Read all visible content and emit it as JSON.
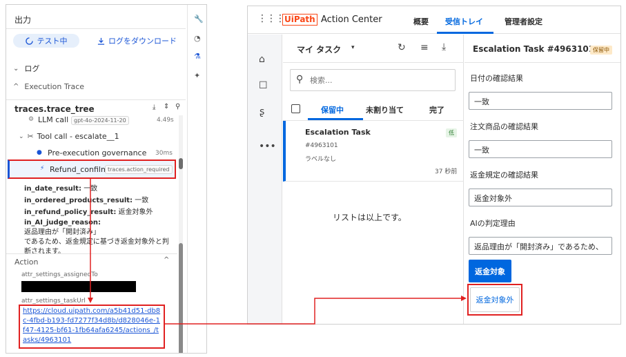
{
  "left": {
    "title": "出力",
    "status_chip": "テスト中",
    "download_logs": "ログをダウンロード",
    "log_label": "ログ",
    "execution_trace_label": "Execution Trace",
    "trace_tree_title": "traces.trace_tree",
    "trace_items": {
      "llm_call": "LLM call",
      "llm_model": "gpt-4o-2024-11-20",
      "llm_time": "4.49s",
      "tool_call": "Tool call - escalate__1",
      "pre_exec": "Pre-execution governance",
      "pre_exec_time": "30ms",
      "refund": "Refund_confilm",
      "refund_tag": "traces.action_required"
    },
    "results": {
      "date_key": "in_date_result:",
      "date_val": "一致",
      "ordered_key": "in_ordered_products_result:",
      "ordered_val": "一致",
      "refund_key": "in_refund_policy_result:",
      "refund_val": "返金対象外",
      "judge_key": "in_AI_judge_reason:",
      "judge_line1": "返品理由が「開封済み」",
      "judge_line2": "であるため、返金規定に基づき返金対象外と判",
      "judge_line3": "断されます。"
    },
    "action_label": "Action",
    "assigned_to_label": "attr_settings_assignedTo",
    "task_url_label": "attr_settings_taskUrl",
    "task_url": "https://cloud.uipath.com/a5b41d51-db8c-4fbd-b193-fd7277f34d8b/d828046e-1f47-4125-bf61-1fb64afa6245/actions_/tasks/4963101"
  },
  "right": {
    "brand_logo": "UiPath",
    "app_name": "Action Center",
    "tabs": [
      "概要",
      "受信トレイ",
      "管理者設定"
    ],
    "my_tasks": "マイ タスク",
    "search_placeholder": "検索...",
    "list_tabs": [
      "保留中",
      "未割り当て",
      "完了"
    ],
    "task": {
      "title": "Escalation Task",
      "priority": "低",
      "id": "#4963101",
      "label": "ラベルなし",
      "age": "37 秒前"
    },
    "end_of_list": "リストは以上です。",
    "detail": {
      "title": "Escalation Task #4963101",
      "status": "保留中",
      "fields": [
        {
          "label": "日付の確認結果",
          "value": "一致"
        },
        {
          "label": "注文商品の確認結果",
          "value": "一致"
        },
        {
          "label": "返金規定の確認結果",
          "value": "返金対象外"
        },
        {
          "label": "AIの判定理由",
          "value": "返品理由が「開封済み」であるため、"
        }
      ],
      "btn_primary": "返金対象",
      "btn_secondary": "返金対象外"
    }
  },
  "colors": {
    "accent": "#0067df",
    "highlight": "#e02020",
    "brand": "#fa4616",
    "badge_green": "#e6f4e6",
    "badge_orange": "#fde9c8"
  }
}
